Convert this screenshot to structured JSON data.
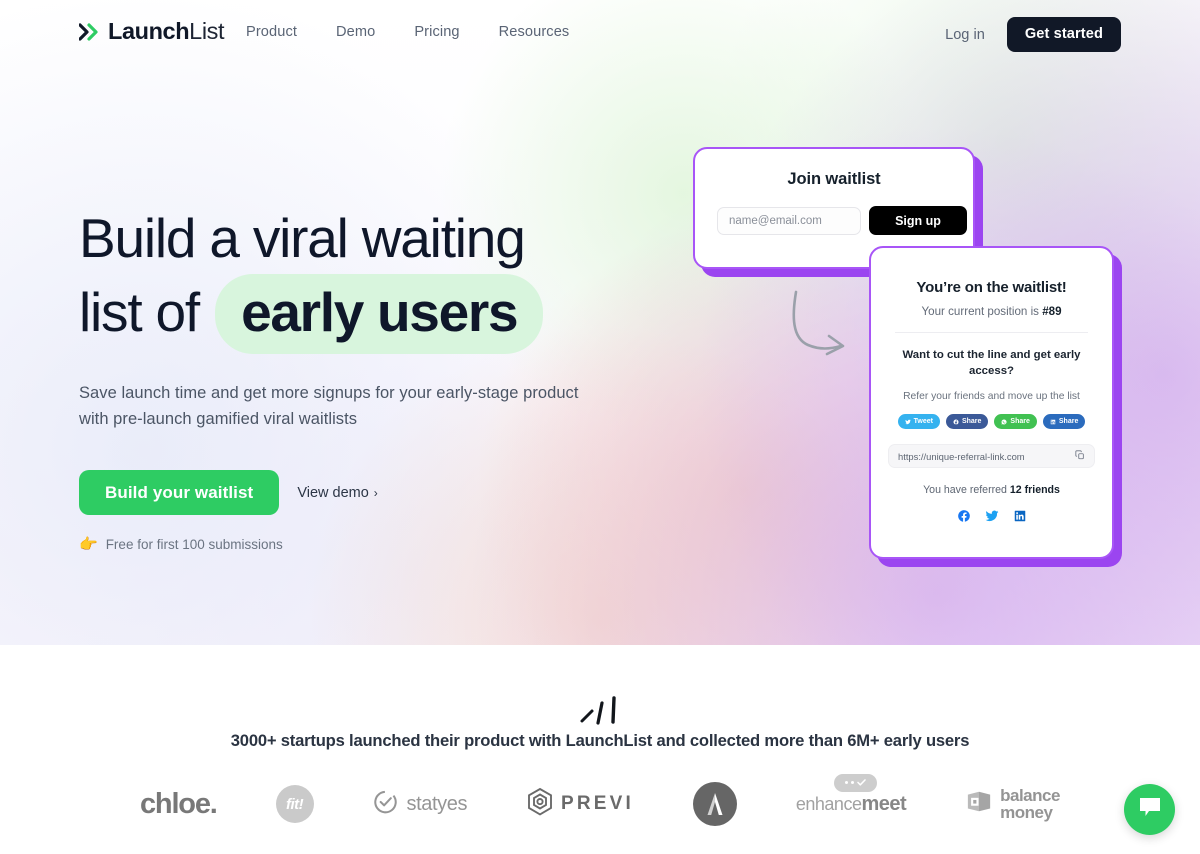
{
  "header": {
    "logo": {
      "mark": "double-chevron",
      "bold": "Launch",
      "light": "List"
    },
    "nav": [
      {
        "label": "Product"
      },
      {
        "label": "Demo"
      },
      {
        "label": "Pricing"
      },
      {
        "label": "Resources"
      }
    ],
    "login_label": "Log in",
    "cta_label": "Get started"
  },
  "hero": {
    "headline_line1": "Build a viral waiting",
    "headline_line2_prefix": "list of",
    "headline_highlight": "early users",
    "subhead": "Save launch time and get more signups for your early-stage product with pre-launch gamified viral waitlists",
    "primary_cta": "Build your waitlist",
    "demo_link": "View demo",
    "demo_chevron": "›",
    "free_note": "Free for first 100 submissions",
    "free_note_emoji": "👉"
  },
  "join_card": {
    "title": "Join waitlist",
    "email_placeholder": "name@email.com",
    "email_value": "",
    "signup_label": "Sign up"
  },
  "status_card": {
    "title": "You’re on the waitlist!",
    "position_prefix": "Your current position is",
    "position_value": "#89",
    "question": "Want to cut the line and get early access?",
    "refer_hint": "Refer your friends and move up the list",
    "share_buttons": [
      {
        "label": "Tweet",
        "network": "twitter",
        "color": "#35b2ef"
      },
      {
        "label": "Share",
        "network": "facebook",
        "color": "#3b5998"
      },
      {
        "label": "Share",
        "network": "whatsapp",
        "color": "#41c152"
      },
      {
        "label": "Share",
        "network": "linkedin",
        "color": "#2b6bbd"
      }
    ],
    "referral_url": "https://unique-referral-link.com",
    "copy_icon": "copy-icon",
    "referred_prefix": "You have referred",
    "referred_value": "12 friends",
    "social_icons": [
      "facebook-icon",
      "twitter-icon",
      "linkedin-icon"
    ]
  },
  "social_proof": {
    "headline": "3000+ startups launched their product with LaunchList and collected more than 6M+ early users",
    "logos": [
      {
        "name": "chloe",
        "text": "chloe."
      },
      {
        "name": "fit",
        "text": "fit!"
      },
      {
        "name": "statyes",
        "text": "statyes"
      },
      {
        "name": "previ",
        "text": "PREVI"
      },
      {
        "name": "a-circle",
        "text": ""
      },
      {
        "name": "enhancemeet",
        "text_light": "enhance",
        "text_bold": "meet"
      },
      {
        "name": "balance-money",
        "line1": "balance",
        "line2": "money"
      }
    ]
  },
  "chat_widget": {
    "icon": "chat-bubble-icon"
  },
  "colors": {
    "brand_green": "#2ecc63",
    "accent_purple": "#a855f7",
    "purple_shadow": "#9b45f0",
    "dark": "#111827",
    "highlight_mint": "#d8f5dd"
  }
}
